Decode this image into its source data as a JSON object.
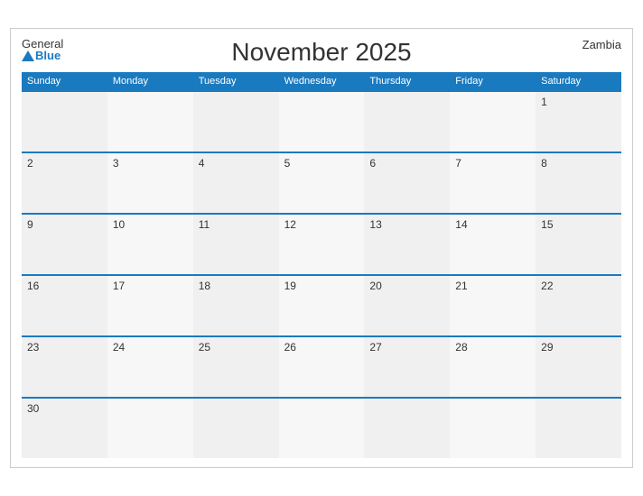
{
  "header": {
    "title": "November 2025",
    "country": "Zambia",
    "logo_general": "General",
    "logo_blue": "Blue"
  },
  "days_of_week": [
    "Sunday",
    "Monday",
    "Tuesday",
    "Wednesday",
    "Thursday",
    "Friday",
    "Saturday"
  ],
  "weeks": [
    [
      null,
      null,
      null,
      null,
      null,
      null,
      1
    ],
    [
      2,
      3,
      4,
      5,
      6,
      7,
      8
    ],
    [
      9,
      10,
      11,
      12,
      13,
      14,
      15
    ],
    [
      16,
      17,
      18,
      19,
      20,
      21,
      22
    ],
    [
      23,
      24,
      25,
      26,
      27,
      28,
      29
    ],
    [
      30,
      null,
      null,
      null,
      null,
      null,
      null
    ]
  ]
}
